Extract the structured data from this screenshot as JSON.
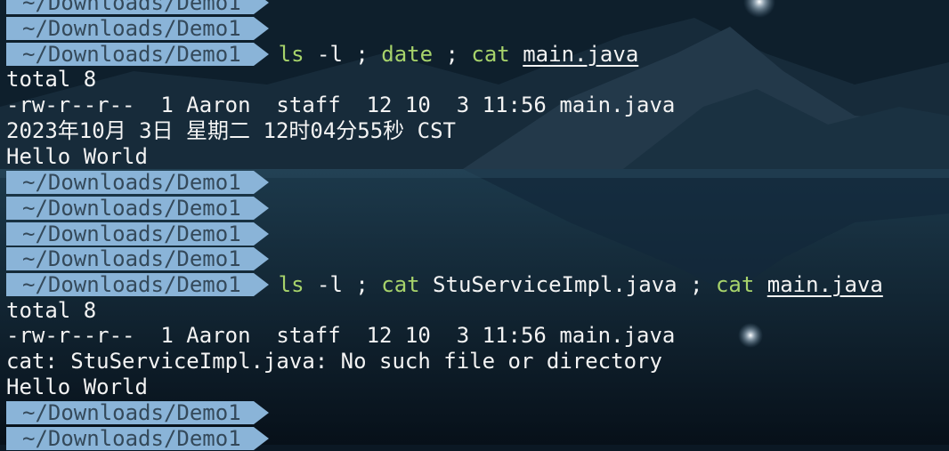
{
  "prompt": {
    "path": "~/Downloads/Demo1"
  },
  "commands": [
    {
      "parts": [
        "ls",
        " -l ; ",
        "date",
        " ; ",
        "cat",
        " ",
        "main.java"
      ]
    },
    {
      "parts": [
        "ls",
        " -l ; ",
        "cat",
        " StuServiceImpl.java ; ",
        "cat",
        " ",
        "main.java"
      ]
    }
  ],
  "output1": {
    "total": "total 8",
    "listing": "-rw-r--r--  1 Aaron  staff  12 10  3 11:56 main.java",
    "date": "2023年10月 3日 星期二 12时04分55秒 CST",
    "hello": "Hello World"
  },
  "output2": {
    "total": "total 8",
    "listing": "-rw-r--r--  1 Aaron  staff  12 10  3 11:56 main.java",
    "error": "cat: StuServiceImpl.java: No such file or directory",
    "hello": "Hello World"
  },
  "colors": {
    "prompt_bg": "#8ab4d8",
    "prompt_text": "#34495a",
    "command_keyword": "#a7d36b",
    "text": "#f3f3f3"
  }
}
